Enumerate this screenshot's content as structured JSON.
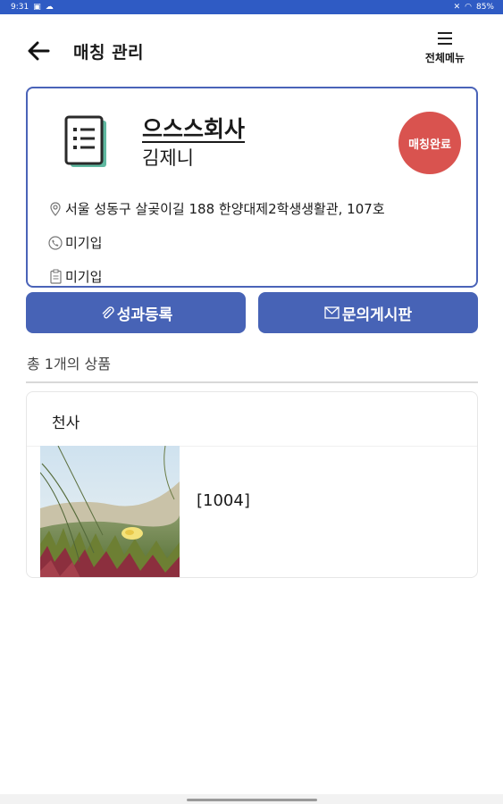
{
  "status_bar": {
    "time": "9:31",
    "battery": "85%",
    "color": "#2f5bc4"
  },
  "header": {
    "back_icon": "arrow-left-icon",
    "title": "매칭 관리",
    "menu_icon": "hamburger-icon",
    "menu_label": "전체메뉴"
  },
  "company": {
    "name": "으스스회사",
    "manager": "김제니",
    "status": "매칭완료",
    "status_color": "#d9534f",
    "border_color": "#4a63b8",
    "address": "서울 성동구 살곶이길 188 한양대제2학생생활관, 107호",
    "phone": "미기입",
    "business_no": "미기입"
  },
  "actions": {
    "performance_label": "성과등록",
    "inquiry_label": "문의게시판",
    "button_color": "#4763b6"
  },
  "products": {
    "count_text": "총 1개의 상품",
    "items": [
      {
        "category": "천사",
        "code": "[1004]"
      }
    ]
  }
}
